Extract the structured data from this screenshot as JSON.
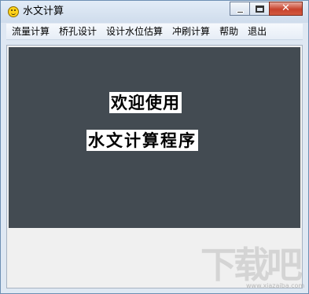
{
  "window": {
    "title": "水文计算",
    "icon": "smiley-face-icon",
    "controls": {
      "minimize": "minimize-icon",
      "maximize": "maximize-icon",
      "close_glyph": "✕"
    }
  },
  "menu": {
    "items": [
      {
        "label": "流量计算"
      },
      {
        "label": "桥孔设计"
      },
      {
        "label": "设计水位估算"
      },
      {
        "label": "冲刷计算"
      },
      {
        "label": "帮助"
      },
      {
        "label": "退出"
      }
    ]
  },
  "main": {
    "welcome_line1": "欢迎使用",
    "welcome_line2": "水文计算程序",
    "panel_color": "#434b52"
  },
  "watermark": {
    "text": "下载吧",
    "url": "www.xiazaiba.com"
  }
}
